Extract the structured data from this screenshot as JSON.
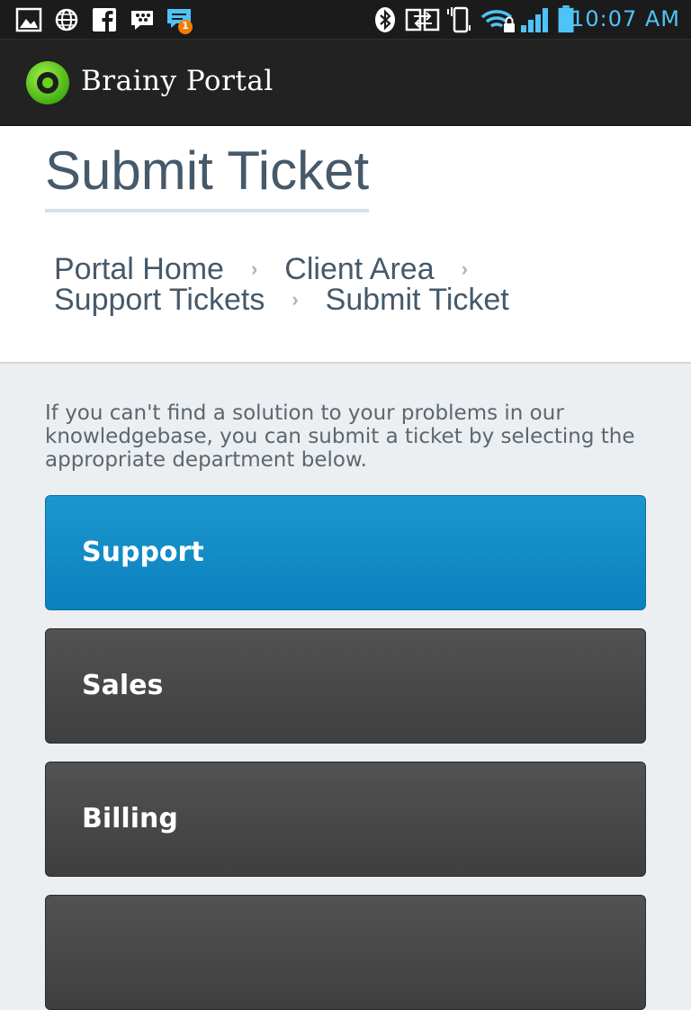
{
  "status_bar": {
    "time": "10:07 AM",
    "notification_badge": "1",
    "left_icons": [
      "gallery-icon",
      "browser-icon",
      "facebook-icon",
      "bbm-icon",
      "chat-notification-icon"
    ],
    "right_icons": [
      "bluetooth-icon",
      "screen-mirroring-icon",
      "vibrate-icon",
      "wifi-locked-icon",
      "signal-icon",
      "battery-icon"
    ],
    "accent_color": "#4fc3f7"
  },
  "app_bar": {
    "brand": "Brainy Portal",
    "logo_icon": "ring-logo-icon",
    "logo_color": "#6ad31a"
  },
  "header": {
    "title": "Submit Ticket",
    "breadcrumb": [
      {
        "label": "Portal Home"
      },
      {
        "label": "Client Area"
      },
      {
        "label": "Support Tickets"
      },
      {
        "label": "Submit Ticket"
      }
    ]
  },
  "main": {
    "intro": "If you can't find a solution to your problems in our knowledgebase, you can submit a ticket by selecting the appropriate department below.",
    "departments": [
      {
        "label": "Support",
        "color": "#1189c6"
      },
      {
        "label": "Sales",
        "color": "#484848"
      },
      {
        "label": "Billing",
        "color": "#484848"
      },
      {
        "label": "",
        "color": "#484848"
      }
    ]
  }
}
